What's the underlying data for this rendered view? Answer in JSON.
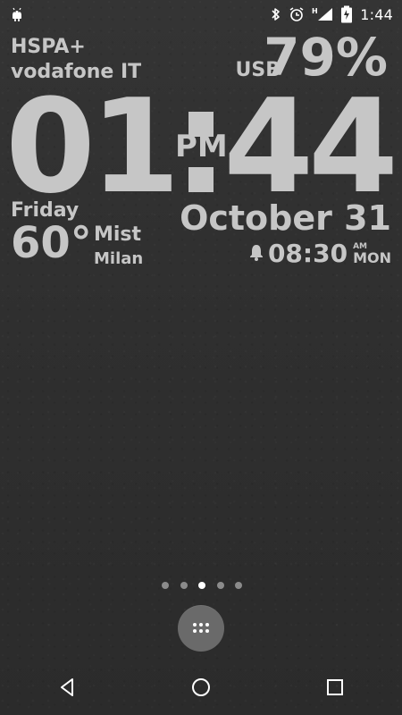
{
  "status_bar": {
    "time": "1:44",
    "icons": {
      "notification": "android-icon",
      "bluetooth": "bluetooth-icon",
      "alarm": "alarm-icon",
      "network": "signal-h-icon",
      "battery": "battery-charging-icon"
    },
    "network_type_label": "H"
  },
  "widget": {
    "network": "HSPA+",
    "carrier": "vodafone IT",
    "power_source": "USB",
    "battery": "79%",
    "hours": "01",
    "ampm": "PM",
    "minutes": "44",
    "day": "Friday",
    "temperature": "60°",
    "weather": "Mist",
    "city": "Milan",
    "date": "October 31",
    "alarm": {
      "time": "08:30",
      "ampm": "AM",
      "day": "MON"
    }
  },
  "home": {
    "page_count": 5,
    "active_page": 3
  },
  "navigation": {
    "back_icon": "back-icon",
    "home_icon": "home-icon",
    "recents_icon": "recents-icon"
  },
  "colors": {
    "background": "#2f2f2f",
    "widget_text": "#c6c6c6",
    "status_text": "#ffffff",
    "drawer_button": "#6a6a6a"
  }
}
